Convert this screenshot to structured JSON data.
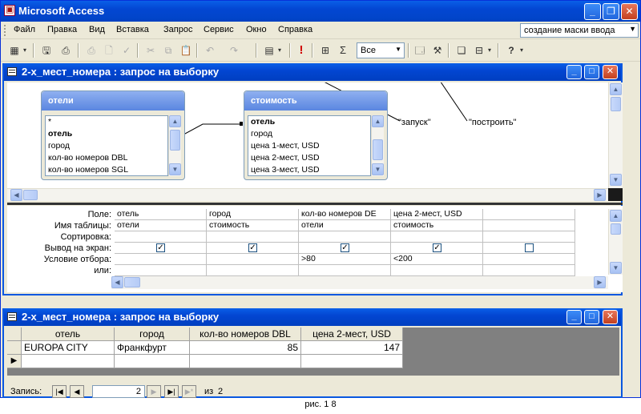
{
  "app": {
    "title": "Microsoft Access",
    "menu": [
      "Файл",
      "Правка",
      "Вид",
      "Вставка",
      "Запрос",
      "Сервис",
      "Окно",
      "Справка"
    ],
    "help_box": "создание маски ввода",
    "toolbar": {
      "top_values_combo": "Все",
      "run_glyph": "!",
      "sum_glyph": "Σ",
      "help_glyph": "?"
    }
  },
  "design_window": {
    "title": "2-х_мест_номера : запрос на выборку",
    "tables": [
      {
        "name": "отели",
        "fields": [
          "*",
          "отель",
          "город",
          "кол-во номеров DBL",
          "кол-во номеров SGL"
        ],
        "key_field": "отель"
      },
      {
        "name": "стоимость",
        "fields": [
          "отель",
          "город",
          "цена 1-мест, USD",
          "цена 2-мест, USD",
          "цена 3-мест, USD"
        ],
        "key_field": "отель"
      }
    ],
    "annotations": {
      "run": "\"запуск\"",
      "build": "\"построить\""
    },
    "grid": {
      "row_labels": [
        "Поле:",
        "Имя таблицы:",
        "Сортировка:",
        "Вывод на экран:",
        "Условие отбора:",
        "или:"
      ],
      "columns": [
        {
          "field": "отель",
          "table": "отели",
          "sort": "",
          "show": true,
          "criteria": "",
          "or": ""
        },
        {
          "field": "город",
          "table": "стоимость",
          "sort": "",
          "show": true,
          "criteria": "",
          "or": ""
        },
        {
          "field": "кол-во номеров DE",
          "table": "отели",
          "sort": "",
          "show": true,
          "criteria": ">80",
          "or": ""
        },
        {
          "field": "цена 2-мест, USD",
          "table": "стоимость",
          "sort": "",
          "show": true,
          "criteria": "<200",
          "or": ""
        },
        {
          "field": "",
          "table": "",
          "sort": "",
          "show": false,
          "criteria": "",
          "or": ""
        }
      ],
      "check_glyph": "✓"
    }
  },
  "datasheet_window": {
    "title": "2-х_мест_номера : запрос на выборку",
    "headers": [
      "отель",
      "город",
      "кол-во номеров DBL",
      "цена 2-мест, USD"
    ],
    "rows": [
      [
        "EUROPA CITY",
        "Франкфурт",
        "85",
        "147"
      ]
    ],
    "new_row_marker": "▶",
    "nav": {
      "label": "Запись:",
      "current": "2",
      "of_label": "из",
      "total": "2"
    }
  },
  "caption": "рис. 1 8"
}
